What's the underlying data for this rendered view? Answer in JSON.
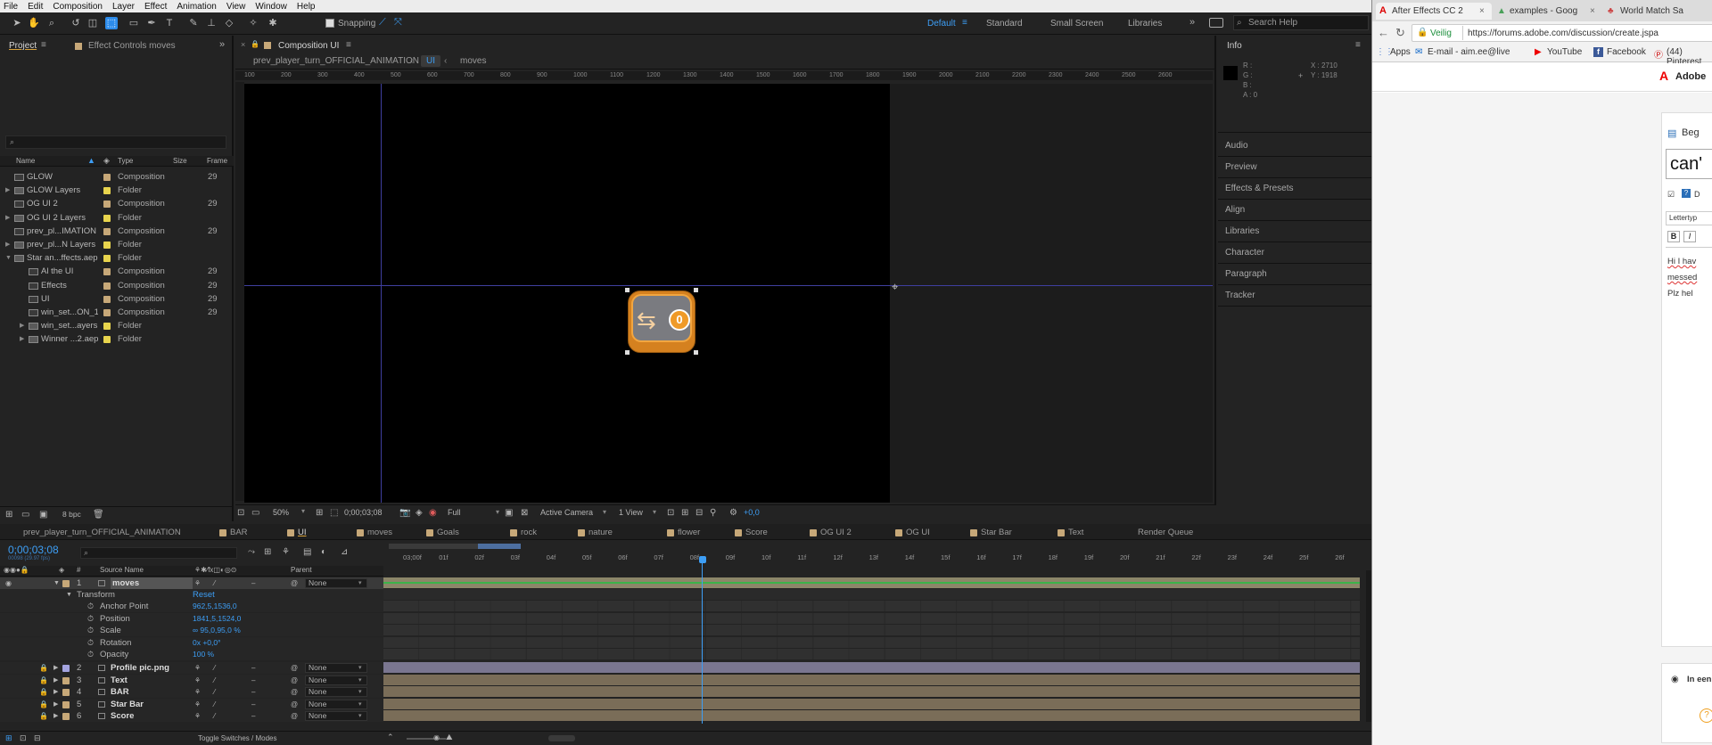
{
  "menu": [
    "File",
    "Edit",
    "Composition",
    "Layer",
    "Effect",
    "Animation",
    "View",
    "Window",
    "Help"
  ],
  "toolbar": {
    "snapping_label": "Snapping",
    "search_placeholder": "Search Help"
  },
  "workspaces": [
    "Default",
    "Standard",
    "Small Screen",
    "Libraries"
  ],
  "project_panel": {
    "tabs": [
      "Project",
      "Effect Controls moves"
    ],
    "search_placeholder": "",
    "columns": [
      "Name",
      "Type",
      "Size",
      "Frame"
    ],
    "items": [
      {
        "name": "GLOW",
        "type": "Composition",
        "frame": "29",
        "color": "#c7a878",
        "indent": 0,
        "twirl": ""
      },
      {
        "name": "GLOW Layers",
        "type": "Folder",
        "frame": "",
        "color": "#e8d44d",
        "indent": 0,
        "twirl": "▶"
      },
      {
        "name": "OG UI 2",
        "type": "Composition",
        "frame": "29",
        "color": "#c7a878",
        "indent": 0,
        "twirl": ""
      },
      {
        "name": "OG UI 2 Layers",
        "type": "Folder",
        "frame": "",
        "color": "#e8d44d",
        "indent": 0,
        "twirl": "▶"
      },
      {
        "name": "prev_pl...IMATION",
        "type": "Composition",
        "frame": "29",
        "color": "#c7a878",
        "indent": 0,
        "twirl": ""
      },
      {
        "name": "prev_pl...N Layers",
        "type": "Folder",
        "frame": "",
        "color": "#e8d44d",
        "indent": 0,
        "twirl": "▶"
      },
      {
        "name": "Star an...ffects.aep",
        "type": "Folder",
        "frame": "",
        "color": "#e8d44d",
        "indent": 0,
        "twirl": "▼"
      },
      {
        "name": "Al the UI",
        "type": "Composition",
        "frame": "29",
        "color": "#c7a878",
        "indent": 1,
        "twirl": ""
      },
      {
        "name": "Effects",
        "type": "Composition",
        "frame": "29",
        "color": "#c7a878",
        "indent": 1,
        "twirl": ""
      },
      {
        "name": "UI",
        "type": "Composition",
        "frame": "29",
        "color": "#c7a878",
        "indent": 1,
        "twirl": ""
      },
      {
        "name": "win_set...ON_1",
        "type": "Composition",
        "frame": "29",
        "color": "#c7a878",
        "indent": 1,
        "twirl": ""
      },
      {
        "name": "win_set...ayers",
        "type": "Folder",
        "frame": "",
        "color": "#e8d44d",
        "indent": 1,
        "twirl": "▶"
      },
      {
        "name": "Winner ...2.aep",
        "type": "Folder",
        "frame": "",
        "color": "#e8d44d",
        "indent": 1,
        "twirl": "▶"
      }
    ],
    "bpc": "8 bpc"
  },
  "comp_panel": {
    "tab": "Composition UI",
    "breadcrumbs": [
      "prev_player_turn_OFFICIAL_ANIMATION",
      "UI",
      "moves"
    ],
    "ruler_ticks": [
      "100",
      "200",
      "300",
      "400",
      "500",
      "600",
      "700",
      "800",
      "900",
      "1000",
      "1100",
      "1200",
      "1300",
      "1400",
      "1500",
      "1600",
      "1700",
      "1800",
      "1900",
      "2000",
      "2100",
      "2200",
      "2300",
      "2400",
      "2500",
      "2600"
    ],
    "zoom": "50%",
    "timecode": "0;00;03;08",
    "resolution": "Full",
    "camera": "Active Camera",
    "views": "1 View",
    "exposure": "+0,0",
    "badge_number": "0"
  },
  "info_panel": {
    "title": "Info",
    "r": "R :",
    "g": "G :",
    "b": "B :",
    "a": "A : 0",
    "x": "X : 2710",
    "y": "Y : 1918"
  },
  "right_panels": [
    "Audio",
    "Preview",
    "Effects & Presets",
    "Align",
    "Libraries",
    "Character",
    "Paragraph",
    "Tracker"
  ],
  "timeline": {
    "tabs": [
      "prev_player_turn_OFFICIAL_ANIMATION",
      "BAR",
      "UI",
      "moves",
      "Goals",
      "rock",
      "nature",
      "flower",
      "Score",
      "OG UI 2",
      "OG UI",
      "Star Bar",
      "Text",
      "Render Queue"
    ],
    "timecode": "0;00;03;08",
    "fps": "00098 (29.97 fps)",
    "columns": [
      "#",
      "Source Name",
      "Parent"
    ],
    "ruler": [
      "03;00f",
      "01f",
      "02f",
      "03f",
      "04f",
      "05f",
      "06f",
      "07f",
      "08f",
      "09f",
      "10f",
      "11f",
      "12f",
      "13f",
      "14f",
      "15f",
      "16f",
      "17f",
      "18f",
      "19f",
      "20f",
      "21f",
      "22f",
      "23f",
      "24f",
      "25f",
      "26f"
    ],
    "layers": [
      {
        "num": "1",
        "name": "moves",
        "parent": "None",
        "color": "#c7a878"
      },
      {
        "num": "2",
        "name": "Profile pic.png",
        "parent": "None",
        "color": "#a4a4e0"
      },
      {
        "num": "3",
        "name": "Text",
        "parent": "None",
        "color": "#c7a878"
      },
      {
        "num": "4",
        "name": "BAR",
        "parent": "None",
        "color": "#c7a878"
      },
      {
        "num": "5",
        "name": "Star Bar",
        "parent": "None",
        "color": "#c7a878"
      },
      {
        "num": "6",
        "name": "Score",
        "parent": "None",
        "color": "#c7a878"
      }
    ],
    "transform": {
      "label": "Transform",
      "reset": "Reset",
      "props": [
        {
          "name": "Anchor Point",
          "value": "962,5,1536,0"
        },
        {
          "name": "Position",
          "value": "1841,5,1524,0"
        },
        {
          "name": "Scale",
          "value": "∞ 95,0,95,0 %"
        },
        {
          "name": "Rotation",
          "value": "0x +0,0°"
        },
        {
          "name": "Opacity",
          "value": "100 %"
        }
      ]
    },
    "toggle_label": "Toggle Switches / Modes"
  },
  "browser": {
    "tabs": [
      "After Effects CC 2",
      "examples - Goog",
      "World Match Sa"
    ],
    "url": "https://forums.adobe.com/discussion/create.jspa",
    "secure_label": "Veilig",
    "bookmarks": [
      "Apps",
      "E-mail - aim.ee@live",
      "YouTube",
      "Facebook",
      "(44) Pinterest"
    ],
    "adobe_label": "Adobe",
    "page_texts": {
      "heading": "Beg",
      "input": "can'",
      "check": "D",
      "font": "Lettertyp",
      "bold": "B",
      "italic": "I",
      "line1": "Hi I hav",
      "line2": "messed",
      "line3": "Plz hel",
      "radio": "In een"
    }
  }
}
